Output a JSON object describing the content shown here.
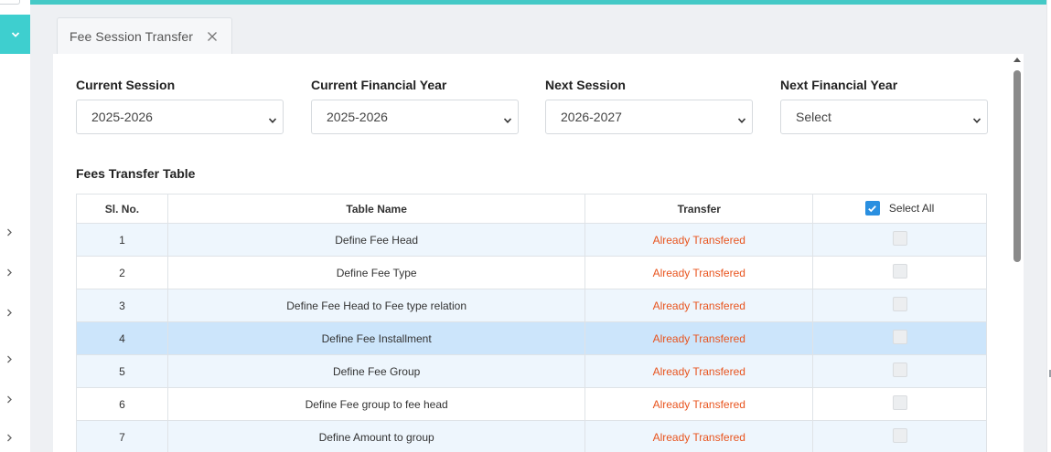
{
  "tab": {
    "label": "Fee Session Transfer"
  },
  "filters": [
    {
      "label": "Current Session",
      "value": "2025-2026"
    },
    {
      "label": "Current Financial Year",
      "value": "2025-2026"
    },
    {
      "label": "Next Session",
      "value": "2026-2027"
    },
    {
      "label": "Next Financial Year",
      "value": "Select"
    }
  ],
  "table": {
    "title": "Fees Transfer Table",
    "headers": {
      "sl": "Sl. No.",
      "name": "Table Name",
      "transfer": "Transfer",
      "select_all": "Select All"
    },
    "rows": [
      {
        "sl": "1",
        "name": "Define Fee Head",
        "status": "Already Transfered"
      },
      {
        "sl": "2",
        "name": "Define Fee Type",
        "status": "Already Transfered"
      },
      {
        "sl": "3",
        "name": "Define Fee Head to Fee type relation",
        "status": "Already Transfered"
      },
      {
        "sl": "4",
        "name": "Define Fee Installment",
        "status": "Already Transfered"
      },
      {
        "sl": "5",
        "name": "Define Fee Group",
        "status": "Already Transfered"
      },
      {
        "sl": "6",
        "name": "Define Fee group to fee head",
        "status": "Already Transfered"
      },
      {
        "sl": "7",
        "name": "Define Amount to group",
        "status": "Already Transfered"
      }
    ]
  },
  "colors": {
    "accent": "#44c9c6",
    "status_text": "#e8541e",
    "highlight_row": "#cce5fb",
    "checkbox": "#2a8fe0"
  },
  "icons": {
    "tab_close": "close-icon",
    "select_caret": "chevron-down-icon",
    "sidebar_arrow": "chevron-right-icon"
  }
}
